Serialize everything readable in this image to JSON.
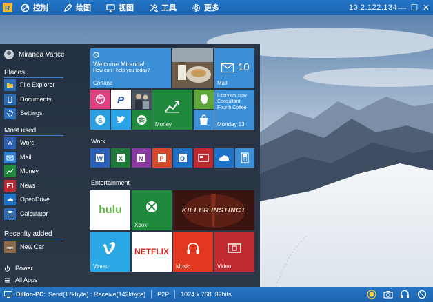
{
  "toolbar": {
    "logo_text": "R",
    "menu": [
      {
        "label": "控制",
        "icon": "control-icon"
      },
      {
        "label": "绘图",
        "icon": "pen-icon"
      },
      {
        "label": "视图",
        "icon": "monitor-icon"
      },
      {
        "label": "工具",
        "icon": "tools-icon"
      },
      {
        "label": "更多",
        "icon": "gear-icon"
      }
    ],
    "ip": "10.2.122.134",
    "window_buttons": {
      "minimize": "—",
      "maximize": "☐",
      "close": "✕"
    }
  },
  "start_menu": {
    "user": "Miranda Vance",
    "places_title": "Places",
    "places": [
      {
        "label": "File Explorer",
        "color": "#2b6cb8"
      },
      {
        "label": "Documents",
        "color": "#2b6cb8"
      },
      {
        "label": "Settings",
        "color": "#2b6cb8"
      }
    ],
    "most_used_title": "Most used",
    "most_used": [
      {
        "label": "Word",
        "color": "#2a5fb5"
      },
      {
        "label": "Mail",
        "color": "#2f7fd4"
      },
      {
        "label": "Money",
        "color": "#1f8a3c"
      },
      {
        "label": "News",
        "color": "#c0292f"
      },
      {
        "label": "OpenDrive",
        "color": "#1e73c9"
      },
      {
        "label": "Calculator",
        "color": "#2b6cb8"
      }
    ],
    "recent_title": "Recenlty added",
    "recent": [
      {
        "label": "New Car"
      }
    ],
    "power": "Power",
    "all_apps": "All Apps",
    "tiles": {
      "cortana_greeting": "Welcome Miranda!",
      "cortana_sub": "How can I help you today?",
      "cortana_label": "Cortana",
      "mail_label": "Mail",
      "mail_count": "10",
      "money_label": "Money",
      "calendar_text": "Interview new Consultant Fourth Coffee",
      "calendar_date": "Monday 13",
      "work_title": "Work",
      "entertainment_title": "Entertainment",
      "hulu": "hulu",
      "xbox_label": "Xbox",
      "killer_instinct": "KILLER INSTINCT",
      "vimeo_label": "Vimeo",
      "netflix": "NETFLIX",
      "music_label": "Music",
      "video_label": "Video"
    }
  },
  "statusbar": {
    "computer": "Dillon-PC",
    "transfer": "Send(17kbyte) : Receive(142kbyte)",
    "mode": "P2P",
    "resolution": "1024 x 768, 32bits"
  },
  "colors": {
    "accent": "#1b63b1",
    "tile_blue": "#3a8fd6",
    "tile_green": "#1f8a3c",
    "tile_red": "#e3381f"
  }
}
